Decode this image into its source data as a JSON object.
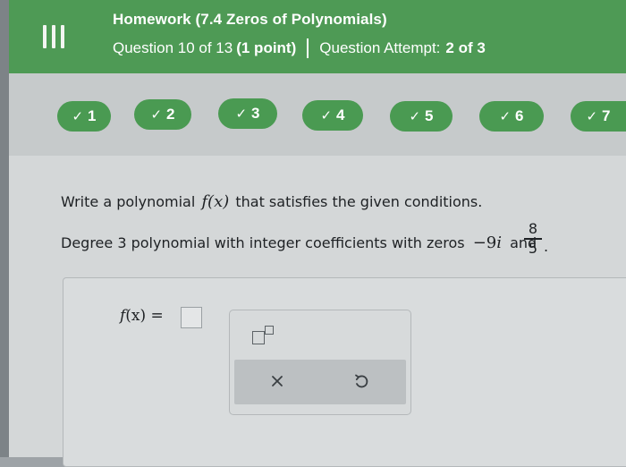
{
  "header": {
    "menu_icon": "hamburger-menu-icon",
    "title": "Homework (7.4 Zeros of Polynomials)",
    "question_progress": "Question 10 of 13",
    "points": "(1 point)",
    "attempt_label": "Question Attempt:",
    "attempt_value": "2 of 3"
  },
  "nav": {
    "check_glyph": "✓",
    "items": [
      {
        "label": "1"
      },
      {
        "label": "2"
      },
      {
        "label": "3"
      },
      {
        "label": "4"
      },
      {
        "label": "5"
      },
      {
        "label": "6"
      },
      {
        "label": "7"
      }
    ]
  },
  "question": {
    "line1_prefix": "Write a polynomial",
    "fx": "f(x)",
    "line1_suffix": "that satisfies the given conditions.",
    "line2_prefix": "Degree 3 polynomial with integer coefficients with zeros",
    "zero1_num": "−9",
    "zero1_i": "i",
    "and": "and",
    "frac_num": "8",
    "frac_den": "5",
    "period": "."
  },
  "answer": {
    "label_f": "f",
    "label_rest": "(x) ="
  },
  "toolbar": {
    "exponent_icon": "exponent-template-icon",
    "clear_icon": "clear-x-icon",
    "undo_icon": "undo-icon"
  },
  "colors": {
    "header_green": "#4e9a55",
    "pill_green": "#4a9a52",
    "text_dark": "#1e2124"
  }
}
